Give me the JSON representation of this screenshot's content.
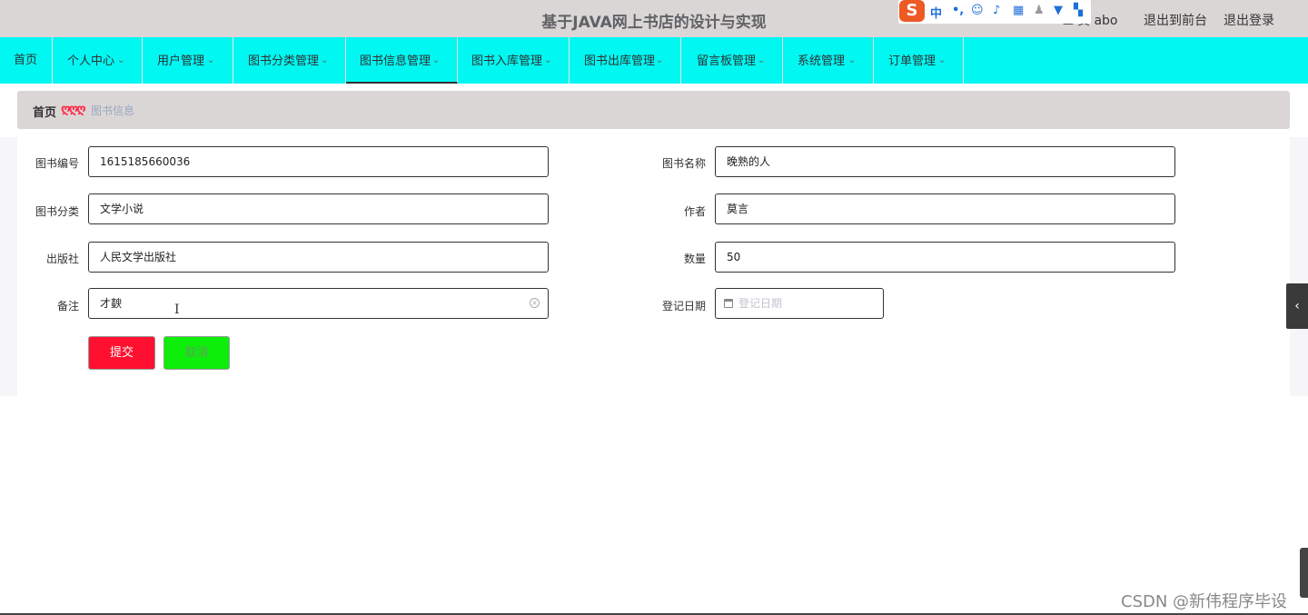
{
  "header": {
    "title": "基于JAVA网上书店的设计与实现",
    "user": "员 abo",
    "exit_front": "退出到前台",
    "logout": "退出登录"
  },
  "ime": {
    "logo": "S",
    "lang": "中",
    "punct": "•,"
  },
  "nav": [
    {
      "label": "首页",
      "has_chevron": false
    },
    {
      "label": "个人中心",
      "has_chevron": true
    },
    {
      "label": "用户管理",
      "has_chevron": true
    },
    {
      "label": "图书分类管理",
      "has_chevron": true
    },
    {
      "label": "图书信息管理",
      "has_chevron": true,
      "active": true
    },
    {
      "label": "图书入库管理",
      "has_chevron": true
    },
    {
      "label": "图书出库管理",
      "has_chevron": true
    },
    {
      "label": "留言板管理",
      "has_chevron": true
    },
    {
      "label": "系统管理",
      "has_chevron": true
    },
    {
      "label": "订单管理",
      "has_chevron": true
    }
  ],
  "breadcrumb": {
    "home": "首页",
    "separator": "ღღღ",
    "current": "图书信息"
  },
  "form": {
    "book_no": {
      "label": "图书编号",
      "value": "1615185660036"
    },
    "book_name": {
      "label": "图书名称",
      "value": "晚熟的人"
    },
    "category": {
      "label": "图书分类",
      "value": "文学小说"
    },
    "author": {
      "label": "作者",
      "value": "莫言"
    },
    "publisher": {
      "label": "出版社",
      "value": "人民文学出版社"
    },
    "quantity": {
      "label": "数量",
      "value": "50"
    },
    "remark": {
      "label": "备注",
      "value": "才斔"
    },
    "reg_date": {
      "label": "登记日期",
      "placeholder": "登记日期"
    },
    "submit": "提交",
    "cancel": "取消"
  },
  "watermark": "CSDN @新伟程序毕设",
  "colors": {
    "header_bg": "#dbd6d6",
    "nav_bg": "#00f7f2",
    "submit_bg": "#ff1030",
    "cancel_bg": "#0dee0a"
  }
}
